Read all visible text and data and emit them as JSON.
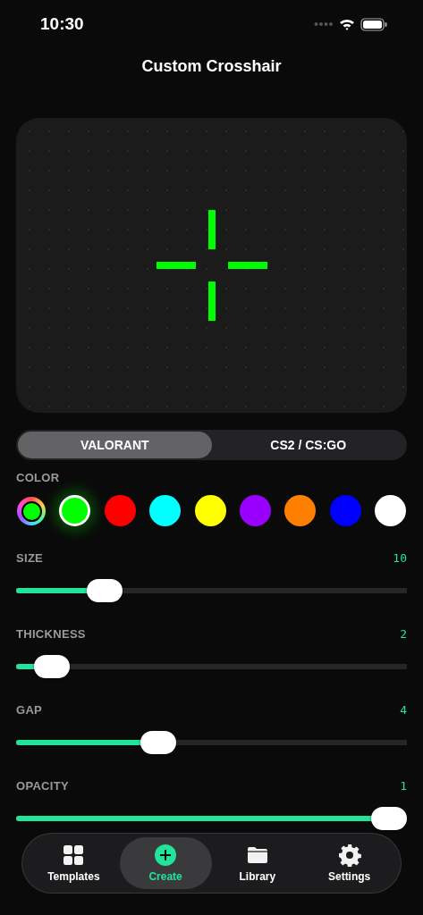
{
  "status_bar": {
    "time": "10:30"
  },
  "title": "Custom Crosshair",
  "game_tabs": [
    {
      "label": "VALORANT",
      "selected": true
    },
    {
      "label": "CS2 / CS:GO",
      "selected": false
    }
  ],
  "color_section": {
    "label": "COLOR",
    "swatches": [
      {
        "kind": "custom",
        "color": "#00ff00",
        "selected": false
      },
      {
        "kind": "preset",
        "color": "#00ff00",
        "selected": true
      },
      {
        "kind": "preset",
        "color": "#ff0000",
        "selected": false
      },
      {
        "kind": "preset",
        "color": "#00ffff",
        "selected": false
      },
      {
        "kind": "preset",
        "color": "#ffff00",
        "selected": false
      },
      {
        "kind": "preset",
        "color": "#9900ff",
        "selected": false
      },
      {
        "kind": "preset",
        "color": "#ff8000",
        "selected": false
      },
      {
        "kind": "preset",
        "color": "#0000ff",
        "selected": false
      },
      {
        "kind": "preset",
        "color": "#ffffff",
        "selected": false
      }
    ]
  },
  "sliders": [
    {
      "label": "SIZE",
      "reading": "10",
      "level": 0.2
    },
    {
      "label": "THICKNESS",
      "reading": "2",
      "level": 0.05
    },
    {
      "label": "GAP",
      "reading": "4",
      "level": 0.35
    },
    {
      "label": "OPACITY",
      "reading": "1",
      "level": 1
    }
  ],
  "tab_bar": [
    {
      "kind": "templates",
      "label": "Templates",
      "selected": false
    },
    {
      "kind": "create",
      "label": "Create",
      "selected": true
    },
    {
      "kind": "library",
      "label": "Library",
      "selected": false
    },
    {
      "kind": "settings",
      "label": "Settings",
      "selected": false
    }
  ]
}
